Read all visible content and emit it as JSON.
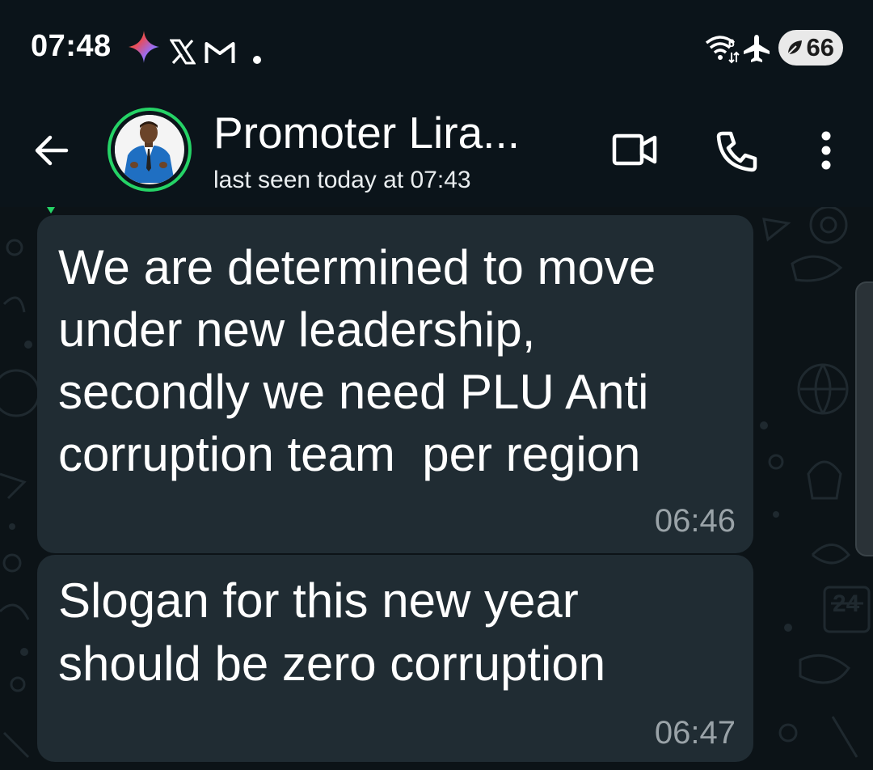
{
  "status_bar": {
    "time": "07:48",
    "notification_icons": [
      "gemini-sparkle-icon",
      "x-icon",
      "gmail-icon",
      "dot-icon"
    ],
    "right_icons": [
      "wifi-icon",
      "airplane-icon"
    ],
    "battery_level": "66",
    "battery_saver": true
  },
  "header": {
    "contact_name": "Promoter Lira...",
    "last_seen": "last seen today at 07:43",
    "actions": [
      "video-call-icon",
      "voice-call-icon",
      "more-options-icon"
    ]
  },
  "messages": [
    {
      "lines": [
        "We are determined to move",
        "under new leadership,",
        "secondly we need PLU Anti",
        "corruption team  per region"
      ],
      "time": "06:46"
    },
    {
      "lines": [
        "Slogan for this new year",
        "should be zero corruption"
      ],
      "time": "06:47"
    }
  ],
  "colors": {
    "background": "#0b141a",
    "chat_background": "#0c1317",
    "bubble": "#202c33",
    "online_ring": "#25d366",
    "timestamp": "#9aa3a8"
  }
}
